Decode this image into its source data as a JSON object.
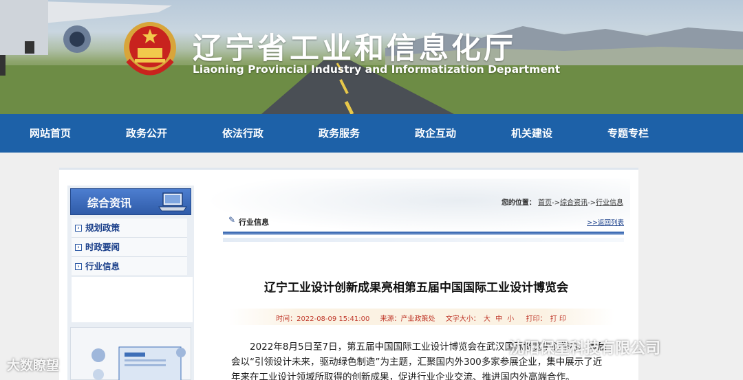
{
  "banner": {
    "title_cn": "辽宁省工业和信息化厅",
    "title_en": "Liaoning Provincial Industry and Informatization Department"
  },
  "nav": {
    "items": [
      "网站首页",
      "政务公开",
      "依法行政",
      "政务服务",
      "政企互动",
      "机关建设",
      "专题专栏"
    ]
  },
  "sidebar": {
    "heading": "综合资讯",
    "items": [
      {
        "label": "规划政策"
      },
      {
        "label": "时政要闻"
      },
      {
        "label": "行业信息"
      }
    ]
  },
  "location": {
    "prefix": "您的位置：",
    "crumbs": [
      "首页",
      "综合资讯",
      "行业信息"
    ],
    "sep": "->"
  },
  "section": {
    "title": "行业信息",
    "back_link": ">>返回列表"
  },
  "article": {
    "title": "辽宁工业设计创新成果亮相第五届中国国际工业设计博览会",
    "time": "时间：2022-08-09 15:41:00",
    "source": "来源：产业政策处",
    "font_size_label": "文字大小：",
    "font_size_options": [
      "大",
      "中",
      "小"
    ],
    "print_label": "打印：",
    "print_link": "打 印",
    "body": "2022年8月5日至7日，第五届中国国际工业设计博览会在武汉国际博览中心举办。本届会以“引领设计未来，驱动绿色制造”为主题，汇聚国内外300多家参展企业，集中展示了近年来在工业设计领域所取得的创新成果，促进行业企业交流、推进国内外高端合作。"
  },
  "watermarks": {
    "left": "大数瞭望",
    "right": "沈阳保星科技有限公司"
  },
  "colors": {
    "nav_bg": "#1d61a8",
    "side_head": "#2f5ba8",
    "meta_red": "#c0392b",
    "link_blue": "#1a3f8a"
  }
}
